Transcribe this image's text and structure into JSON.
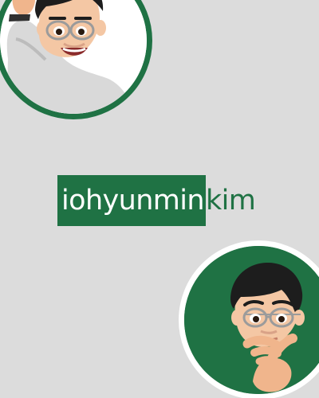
{
  "profile": {
    "name_primary": "iohyunmin",
    "name_secondary": "kim"
  },
  "colors": {
    "background": "#dcdcdc",
    "accent": "#1f7244",
    "white": "#ffffff"
  },
  "avatars": [
    {
      "pose": "waving"
    },
    {
      "pose": "thinking"
    }
  ]
}
